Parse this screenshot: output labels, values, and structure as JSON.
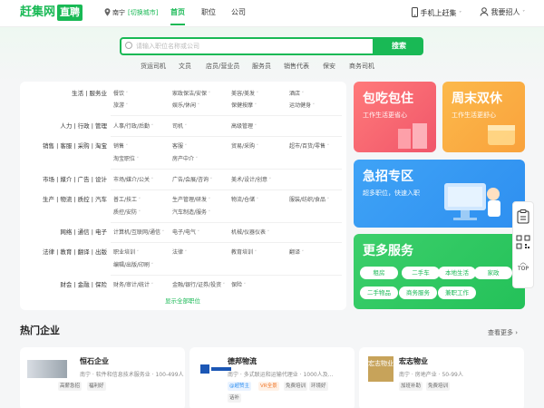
{
  "header": {
    "logo": "赶集网",
    "logo_tag": "直聘",
    "city": "南宁",
    "city_switch": "[切换城市]",
    "nav": [
      "首页",
      "职位",
      "公司"
    ],
    "mobile": "手机上赶集",
    "hire": "我要招人"
  },
  "search": {
    "placeholder": "请输入职位名称或公司",
    "button": "搜索",
    "hot": [
      "货运司机",
      "文员",
      "店员/营业员",
      "服务员",
      "销售代表",
      "保安",
      "商务司机"
    ]
  },
  "categories": [
    {
      "label": "生活 | 服务业",
      "items": [
        "餐饮",
        "家政保洁/安保",
        "美容/美发",
        "酒店",
        "旅游",
        "娱乐/休闲",
        "保健按摩",
        "运动健身"
      ]
    },
    {
      "label": "人力 | 行政 | 管理",
      "items": [
        "人事/行政/后勤",
        "司机",
        "高级管理"
      ]
    },
    {
      "label": "销售 | 客服 | 采购 | 淘宝",
      "items": [
        "销售",
        "客服",
        "贸易/采购",
        "超市/百货/零售",
        "淘宝职位",
        "房产中介"
      ]
    },
    {
      "label": "市场 | 媒介 | 广告 | 设计",
      "items": [
        "市场/媒介/公关",
        "广告/会展/咨询",
        "美术/设计/创意"
      ]
    },
    {
      "label": "生产 | 物流 | 质控 | 汽车",
      "items": [
        "普工/技工",
        "生产管理/研发",
        "物流/仓储",
        "服装/纺织/食品",
        "质控/安防",
        "汽车制造/服务"
      ]
    },
    {
      "label": "网络 | 通信 | 电子",
      "items": [
        "计算机/互联网/通信",
        "电子/电气",
        "机械/仪器仪表"
      ]
    },
    {
      "label": "法律 | 教育 | 翻译 | 出版",
      "items": [
        "职业培训",
        "法律",
        "教育培训",
        "翻译",
        "编辑/出版/印刷"
      ]
    },
    {
      "label": "财会 | 金融 | 保险",
      "items": [
        "财务/审计/统计",
        "金融/银行/证券/投资",
        "保险"
      ]
    }
  ],
  "show_all": "显示全部职位",
  "promo": [
    {
      "title": "包吃包住",
      "sub": "工作生活更省心"
    },
    {
      "title": "周末双休",
      "sub": "工作生活更舒心"
    },
    {
      "title": "急招专区",
      "sub": "超多职位，快速入职"
    },
    {
      "title": "更多服务",
      "pills": [
        "租房",
        "二手车",
        "本地生活",
        "家政",
        "二手物品",
        "商务服务",
        "兼职工作"
      ]
    }
  ],
  "side": {
    "top": "TOP"
  },
  "companies_section": {
    "title": "热门企业",
    "more": "查看更多"
  },
  "companies": [
    {
      "name": "恒石企业",
      "desc": "南宁 · 软件和信息技术服务业 · 100-499人",
      "tags": [
        "高薪急招",
        "福利好"
      ]
    },
    {
      "name": "德邦物流",
      "desc": "南宁 · 多式联运和运输代理业 · 1000人及...",
      "tags": [
        "@超赞主",
        "VR全景",
        "免费培训",
        "环境好",
        "话补"
      ]
    },
    {
      "name": "宏志物业",
      "logo": "宏志物业",
      "desc": "南宁 · 房地产业 · 50-99人",
      "tags": [
        "加班补助",
        "免费培训"
      ]
    }
  ],
  "colors": {
    "brand": "#19b955",
    "red": "#f0566a",
    "orange": "#f9a23c",
    "blue": "#2e8ff0",
    "green": "#24c159"
  }
}
